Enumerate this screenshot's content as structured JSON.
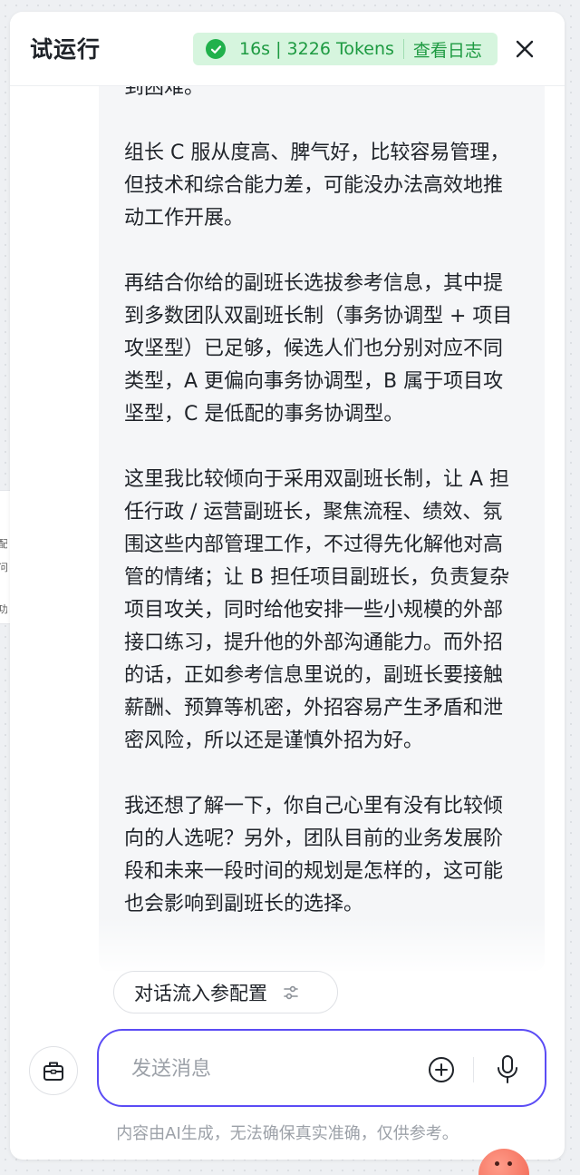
{
  "header": {
    "title": "试运行",
    "status_text": "16s | 3226 Tokens",
    "log_link": "查看日志"
  },
  "side_fragment": [
    "配",
    "问",
    "功"
  ],
  "message": {
    "paragraphs": [
      "到困难。",
      "组长 C 服从度高、脾气好，比较容易管理，但技术和综合能力差，可能没办法高效地推动工作开展。",
      "再结合你给的副班长选拔参考信息，其中提到多数团队双副班长制（事务协调型 + 项目攻坚型）已足够，候选人们也分别对应不同类型，A 更偏向事务协调型，B 属于项目攻坚型，C 是低配的事务协调型。",
      "这里我比较倾向于采用双副班长制，让 A 担任行政 / 运营副班长，聚焦流程、绩效、氛围这些内部管理工作，不过得先化解他对高管的情绪；让 B 担任项目副班长，负责复杂项目攻关，同时给他安排一些小规模的外部接口练习，提升他的外部沟通能力。而外招的话，正如参考信息里说的，副班长要接触薪酬、预算等机密，外招容易产生矛盾和泄密风险，所以还是谨慎外招为好。",
      "我还想了解一下，你自己心里有没有比较倾向的人选呢？另外，团队目前的业务发展阶段和未来一段时间的规划是怎样的，这可能也会影响到副班长的选择。"
    ]
  },
  "config_chip": {
    "label": "对话流入参配置"
  },
  "input": {
    "placeholder": "发送消息",
    "value": ""
  },
  "disclaimer": "内容由AI生成，无法确保真实准确，仅供参考。",
  "colors": {
    "accent": "#5b4cf5",
    "success": "#21b14c",
    "success_bg": "#d6f5de"
  }
}
